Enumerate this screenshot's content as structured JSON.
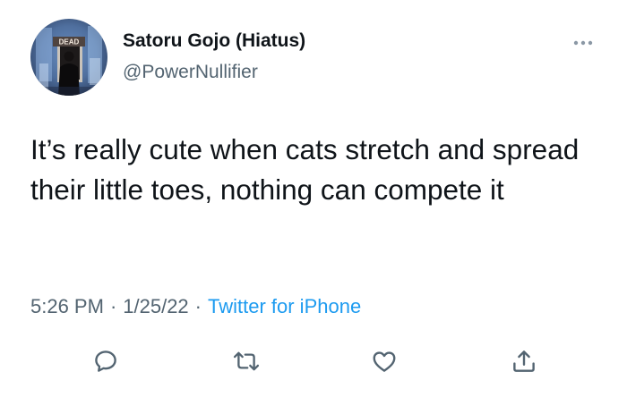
{
  "tweet": {
    "author": {
      "display_name": "Satoru Gojo (Hiatus)",
      "handle": "@PowerNullifier",
      "avatar_sign_text": "DEAD"
    },
    "text": "It’s really cute when cats stretch and spread their little toes, nothing can compete it",
    "time": "5:26 PM",
    "date": "1/25/22",
    "separator": "·",
    "source": "Twitter for iPhone"
  },
  "actions": [
    {
      "icon": "reply-icon"
    },
    {
      "icon": "retweet-icon"
    },
    {
      "icon": "like-icon"
    },
    {
      "icon": "share-icon"
    }
  ],
  "colors": {
    "text": "#0f1419",
    "secondary": "#536471",
    "link": "#1d9bf0",
    "icon": "#536471"
  }
}
